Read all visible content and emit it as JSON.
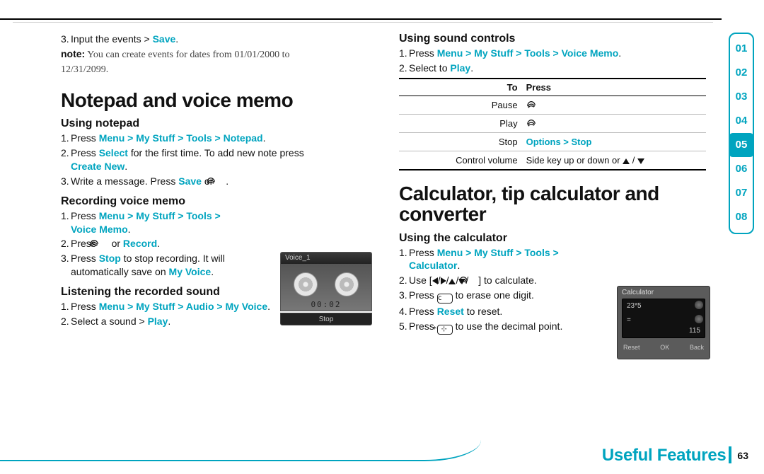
{
  "tabs": {
    "items": [
      "01",
      "02",
      "03",
      "04",
      "05",
      "06",
      "07",
      "08"
    ],
    "active_index": 4
  },
  "footer": {
    "label": "Useful Features",
    "page": "63"
  },
  "leftcol": {
    "intro_step": {
      "n": "3.",
      "before": "Input the events > ",
      "accent": "Save",
      "after": "."
    },
    "note": {
      "label": "note:",
      "txt1": " You can create events for dates from 01/01/2000 to",
      "txt2": "12/31/2099."
    },
    "h1": "Notepad and voice memo",
    "using_notepad": {
      "title": "Using notepad",
      "s1": {
        "n": "1.",
        "before": "Press ",
        "path": "Menu > My Stuff > Tools > Notepad",
        "after": "."
      },
      "s2a": {
        "n": "2.",
        "before": "Press ",
        "accent": "Select",
        "after": " for the first time. To add new note press"
      },
      "s2b": {
        "accent": "Create New",
        "after": "."
      },
      "s3": {
        "n": "3.",
        "before": "Write a message. Press ",
        "accent": "Save",
        "mid": " or ",
        "after": "."
      }
    },
    "recording": {
      "title": "Recording voice memo",
      "s1a": {
        "n": "1.",
        "before": "Press ",
        "path": "Menu > My Stuff > Tools >"
      },
      "s1b": {
        "path": "Voice Memo",
        "after": "."
      },
      "s2": {
        "n": "2.",
        "before": "Press ",
        "mid": " or ",
        "accent": "Record",
        "after": "."
      },
      "s3a": {
        "n": "3.",
        "before": "Press ",
        "accent": "Stop",
        "after": " to stop recording. It will"
      },
      "s3b": {
        "before": "automatically save on ",
        "accent": "My Voice",
        "after": "."
      }
    },
    "listening": {
      "title": "Listening the recorded sound",
      "s1": {
        "n": "1.",
        "before": "Press ",
        "path": "Menu > My Stuff > Audio > My Voice",
        "after": "."
      },
      "s2": {
        "n": "2.",
        "before": "Select a sound > ",
        "accent": "Play",
        "after": "."
      }
    },
    "vm": {
      "title": "Voice_1",
      "time": "00:02",
      "stop": "Stop"
    }
  },
  "rightcol": {
    "sound": {
      "title": "Using sound controls",
      "s1": {
        "n": "1.",
        "before": "Press ",
        "path": "Menu > My Stuff > Tools > Voice Memo",
        "after": "."
      },
      "s2": {
        "n": "2.",
        "before": "Select to ",
        "accent": "Play",
        "after": "."
      },
      "table": {
        "head": {
          "c1": "To",
          "c2": "Press"
        },
        "rows": [
          {
            "c1": "Pause",
            "c2_type": "swirl"
          },
          {
            "c1": "Play",
            "c2_type": "swirl"
          },
          {
            "c1": "Stop",
            "c2_type": "accent",
            "c2": "Options  > Stop"
          },
          {
            "c1": "Control volume",
            "c2_type": "vol",
            "c2_pre": "Side key up or down or "
          }
        ]
      }
    },
    "h1": "Calculator, tip calculator and converter",
    "calc": {
      "title": "Using the calculator",
      "s1a": {
        "n": "1.",
        "before": "Press ",
        "path": "Menu > My Stuff > Tools >"
      },
      "s1b": {
        "path": "Calculator",
        "after": "."
      },
      "s2": {
        "n": "2.",
        "before": "Use [",
        "after": "] to calculate."
      },
      "s3": {
        "n": "3.",
        "before": "Press ",
        "after": " to erase one digit."
      },
      "s4": {
        "n": "4.",
        "before": "Press ",
        "accent": "Reset",
        "after": " to reset."
      },
      "s5": {
        "n": "5.",
        "before": "Press ",
        "after": " to use the decimal point."
      }
    },
    "calc_illus": {
      "title": "Calculator",
      "input": "23*5",
      "eq": "=",
      "result": "115",
      "bl": "Reset",
      "bc": "OK",
      "br": "Back"
    }
  }
}
